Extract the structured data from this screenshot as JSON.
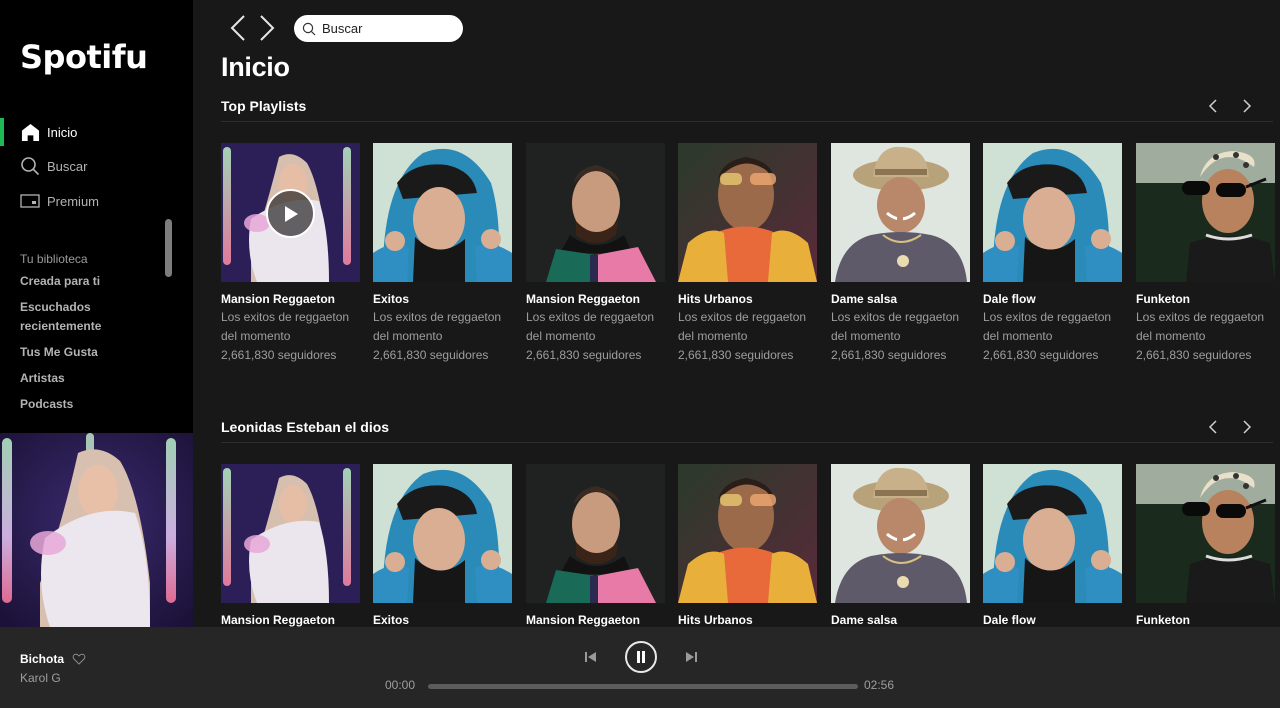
{
  "app": {
    "name": "Spotifu",
    "accent_color": "#1db954"
  },
  "sidebar": {
    "nav": [
      {
        "label": "Inicio",
        "icon": "home-icon",
        "active": true
      },
      {
        "label": "Buscar",
        "icon": "search-icon",
        "active": false
      },
      {
        "label": "Premium",
        "icon": "premium-icon",
        "active": false
      }
    ],
    "library_title": "Tu biblioteca",
    "library": [
      {
        "label": "Creada para ti"
      },
      {
        "label": "Escuchados recientemente"
      },
      {
        "label": "Tus Me Gusta"
      },
      {
        "label": "Artistas"
      },
      {
        "label": "Podcasts"
      }
    ]
  },
  "header": {
    "back_icon": "chevron-left-icon",
    "forward_icon": "chevron-right-icon",
    "search_placeholder": "Buscar"
  },
  "page_title": "Inicio",
  "sections": [
    {
      "title": "Top Playlists",
      "cards": [
        {
          "name": "Mansion Reggaeton",
          "description": "Los exitos de reggaeton del momento",
          "followers": "2,661,830 seguidores",
          "art": "karol",
          "playing_hover": true
        },
        {
          "name": "Exitos",
          "description": "Los exitos de reggaeton del momento",
          "followers": "2,661,830 seguidores",
          "art": "hood"
        },
        {
          "name": "Mansion Reggaeton",
          "description": "Los exitos de reggaeton del momento",
          "followers": "2,661,830 seguidores",
          "art": "maluma"
        },
        {
          "name": "Hits Urbanos",
          "description": "Los exitos de reggaeton del momento",
          "followers": "2,661,830 seguidores",
          "art": "badbunny"
        },
        {
          "name": "Dame salsa",
          "description": "Los exitos de reggaeton del momento",
          "followers": "2,661,830 seguidores",
          "art": "hat"
        },
        {
          "name": "Dale flow",
          "description": "Los exitos de reggaeton del momento",
          "followers": "2,661,830 seguidores",
          "art": "hood"
        },
        {
          "name": "Funketon",
          "description": "Los exitos de reggaeton del momento",
          "followers": "2,661,830 seguidores",
          "art": "shades"
        }
      ]
    },
    {
      "title": "Leonidas Esteban el dios",
      "cards": [
        {
          "name": "Mansion Reggaeton",
          "art": "karol"
        },
        {
          "name": "Exitos",
          "art": "hood"
        },
        {
          "name": "Mansion Reggaeton",
          "art": "maluma"
        },
        {
          "name": "Hits Urbanos",
          "art": "badbunny"
        },
        {
          "name": "Dame salsa",
          "art": "hat"
        },
        {
          "name": "Dale flow",
          "art": "hood"
        },
        {
          "name": "Funketon",
          "art": "shades"
        }
      ]
    }
  ],
  "player": {
    "track": "Bichota",
    "artist": "Karol G",
    "current_time": "00:00",
    "duration": "02:56",
    "progress_percent": 0,
    "state": "playing"
  }
}
